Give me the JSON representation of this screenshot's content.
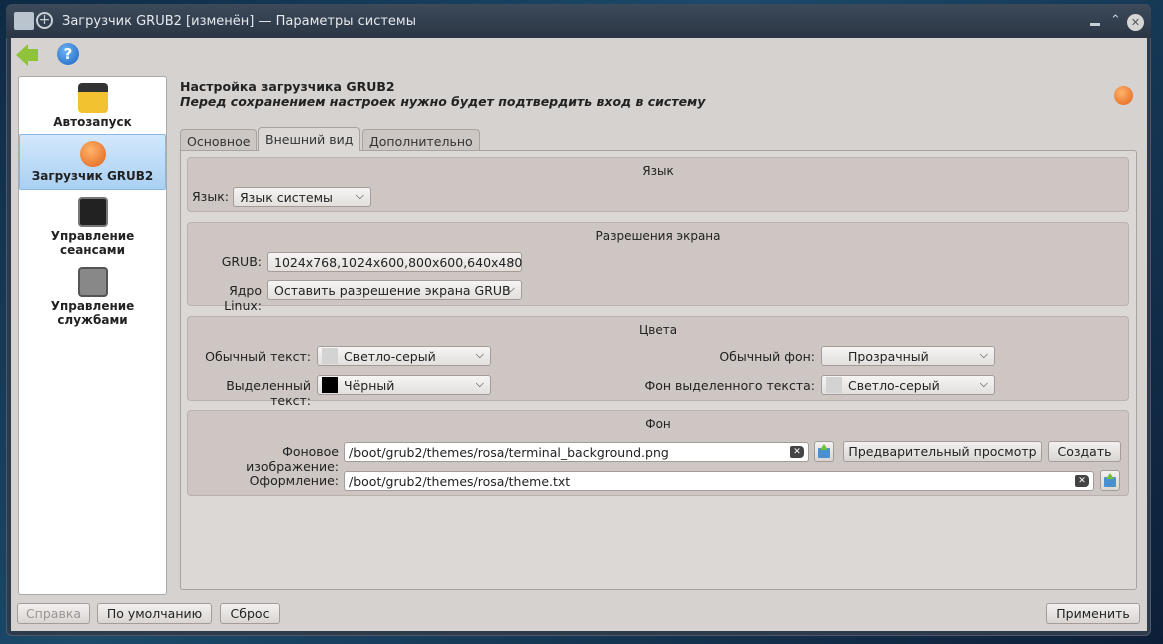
{
  "window": {
    "title": "Загрузчик GRUB2 [изменён] — Параметры системы"
  },
  "sidebar": {
    "items": [
      {
        "label": "Автозапуск"
      },
      {
        "label": "Загрузчик GRUB2"
      },
      {
        "label": "Управление сеансами"
      },
      {
        "label": "Управление службами"
      }
    ]
  },
  "header": {
    "title": "Настройка загрузчика GRUB2",
    "subtitle": "Перед сохранением настроек нужно будет подтвердить вход в систему"
  },
  "tabs": [
    {
      "label": "Основное"
    },
    {
      "label": "Внешний вид"
    },
    {
      "label": "Дополнительно"
    }
  ],
  "language": {
    "group": "Язык",
    "label": "Язык:",
    "value": "Язык системы"
  },
  "resolution": {
    "group": "Разрешения экрана",
    "grub_label": "GRUB:",
    "grub_value": "1024x768,1024x600,800x600,640x480",
    "linux_label": "Ядро Linux:",
    "linux_value": "Оставить разрешение экрана GRUB"
  },
  "colors": {
    "group": "Цвета",
    "normal_text_label": "Обычный текст:",
    "normal_text_value": "Светло-серый",
    "normal_text_color": "#d3d3d3",
    "highlight_text_label": "Выделенный текст:",
    "highlight_text_value": "Чёрный",
    "highlight_text_color": "#000000",
    "normal_bg_label": "Обычный фон:",
    "normal_bg_value": "Прозрачный",
    "highlight_bg_label": "Фон выделенного текста:",
    "highlight_bg_value": "Светло-серый",
    "highlight_bg_color": "#d3d3d3"
  },
  "background": {
    "group": "Фон",
    "image_label": "Фоновое изображение:",
    "image_value": "/boot/grub2/themes/rosa/terminal_background.png",
    "preview_label": "Предварительный просмотр",
    "create_label": "Создать",
    "theme_label": "Оформление:",
    "theme_value": "/boot/grub2/themes/rosa/theme.txt"
  },
  "footer": {
    "help": "Справка",
    "defaults": "По умолчанию",
    "reset": "Сброс",
    "apply": "Применить"
  }
}
